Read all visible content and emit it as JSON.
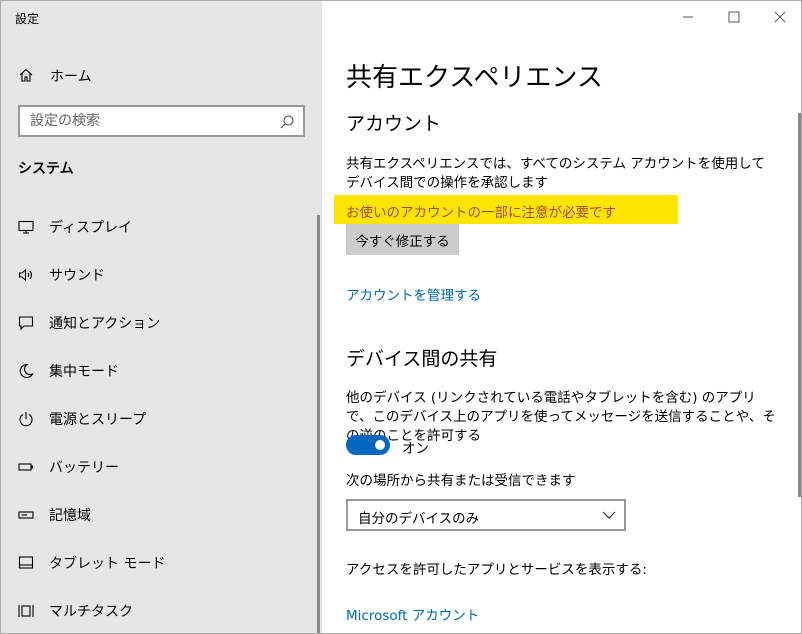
{
  "app": {
    "title": "設定"
  },
  "sidebar": {
    "home_label": "ホーム",
    "search": {
      "placeholder": "設定の検索",
      "value": ""
    },
    "section": "システム",
    "items": [
      {
        "label": "ディスプレイ",
        "icon": "monitor-icon"
      },
      {
        "label": "サウンド",
        "icon": "speaker-icon"
      },
      {
        "label": "通知とアクション",
        "icon": "notification-icon"
      },
      {
        "label": "集中モード",
        "icon": "moon-icon"
      },
      {
        "label": "電源とスリープ",
        "icon": "power-icon"
      },
      {
        "label": "バッテリー",
        "icon": "battery-icon"
      },
      {
        "label": "記憶域",
        "icon": "storage-icon"
      },
      {
        "label": "タブレット モード",
        "icon": "tablet-icon"
      },
      {
        "label": "マルチタスク",
        "icon": "multitask-icon"
      }
    ]
  },
  "main": {
    "title": "共有エクスペリエンス",
    "account": {
      "heading": "アカウント",
      "description": "共有エクスペリエンスでは、すべてのシステム アカウントを使用してデバイス間での操作を承認します",
      "warning": "お使いのアカウントの一部に注意が必要です",
      "fix_button": "今すぐ修正する",
      "manage_link": "アカウントを管理する"
    },
    "device_sharing": {
      "heading": "デバイス間の共有",
      "description": "他のデバイス (リンクされている電話やタブレットを含む) のアプリで、このデバイス上のアプリを使ってメッセージを送信することや、その逆のことを許可する",
      "toggle_state": "オン",
      "share_from_label": "次の場所から共有または受信できます",
      "share_from_value": "自分のデバイスのみ",
      "apps_label": "アクセスを許可したアプリとサービスを表示する:",
      "ms_account_link": "Microsoft アカウント"
    }
  },
  "colors": {
    "accent": "#0067c0",
    "link": "#0067b8",
    "warning_bg": "#ffe600",
    "warning_text": "#b04a00",
    "sidebar_bg": "#e6e6e6"
  }
}
